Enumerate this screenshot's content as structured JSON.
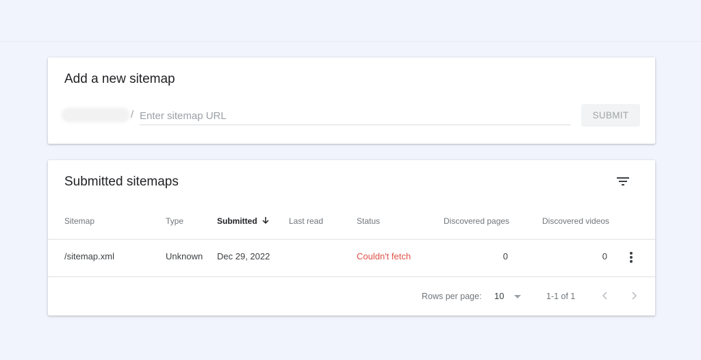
{
  "add_sitemap": {
    "title": "Add a new sitemap",
    "slash": "/",
    "url_placeholder": "Enter sitemap URL",
    "url_value": "",
    "submit_label": "SUBMIT"
  },
  "submitted": {
    "title": "Submitted sitemaps",
    "filter_icon": "filter-icon",
    "columns": {
      "sitemap": "Sitemap",
      "type": "Type",
      "submitted": "Submitted",
      "last_read": "Last read",
      "status": "Status",
      "pages": "Discovered pages",
      "videos": "Discovered videos"
    },
    "sort": {
      "column": "submitted",
      "direction": "descending"
    },
    "rows": [
      {
        "sitemap": "/sitemap.xml",
        "type": "Unknown",
        "submitted": "Dec 29, 2022",
        "last_read": "",
        "status": "Couldn't fetch",
        "pages": "0",
        "videos": "0"
      }
    ],
    "pagination": {
      "rows_per_page_label": "Rows per page:",
      "rows_per_page": "10",
      "range": "1-1 of 1"
    }
  },
  "colors": {
    "background": "#f1f4fc",
    "error": "#d93025",
    "text": "#202124",
    "muted": "#70757a"
  }
}
